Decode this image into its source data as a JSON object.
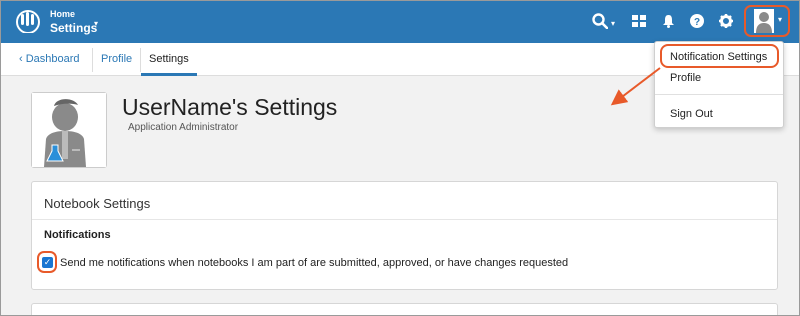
{
  "topbar": {
    "home_label": "Home",
    "project_label": "Settings",
    "caret": "▾",
    "icons": [
      "logo-icon",
      "search-icon",
      "grid-icon",
      "bell-icon",
      "help-icon",
      "gear-icon",
      "user-avatar-icon"
    ],
    "accent": "#2b78b5"
  },
  "breadcrumb": {
    "back_arrow": "‹",
    "dashboard": "Dashboard",
    "profile": "Profile",
    "settings": "Settings"
  },
  "header": {
    "title": "UserName's Settings",
    "role": "Application Administrator"
  },
  "notebook": {
    "section_title": "Notebook Settings",
    "notifications_label": "Notifications",
    "checkbox_checked": true,
    "checkbox_text": "Send me notifications when notebooks I am part of are submitted, approved, or have changes requested"
  },
  "user_menu": {
    "items": [
      "Notification Settings",
      "Profile",
      "Sign Out"
    ]
  },
  "annotation_color": "#e85a2a"
}
